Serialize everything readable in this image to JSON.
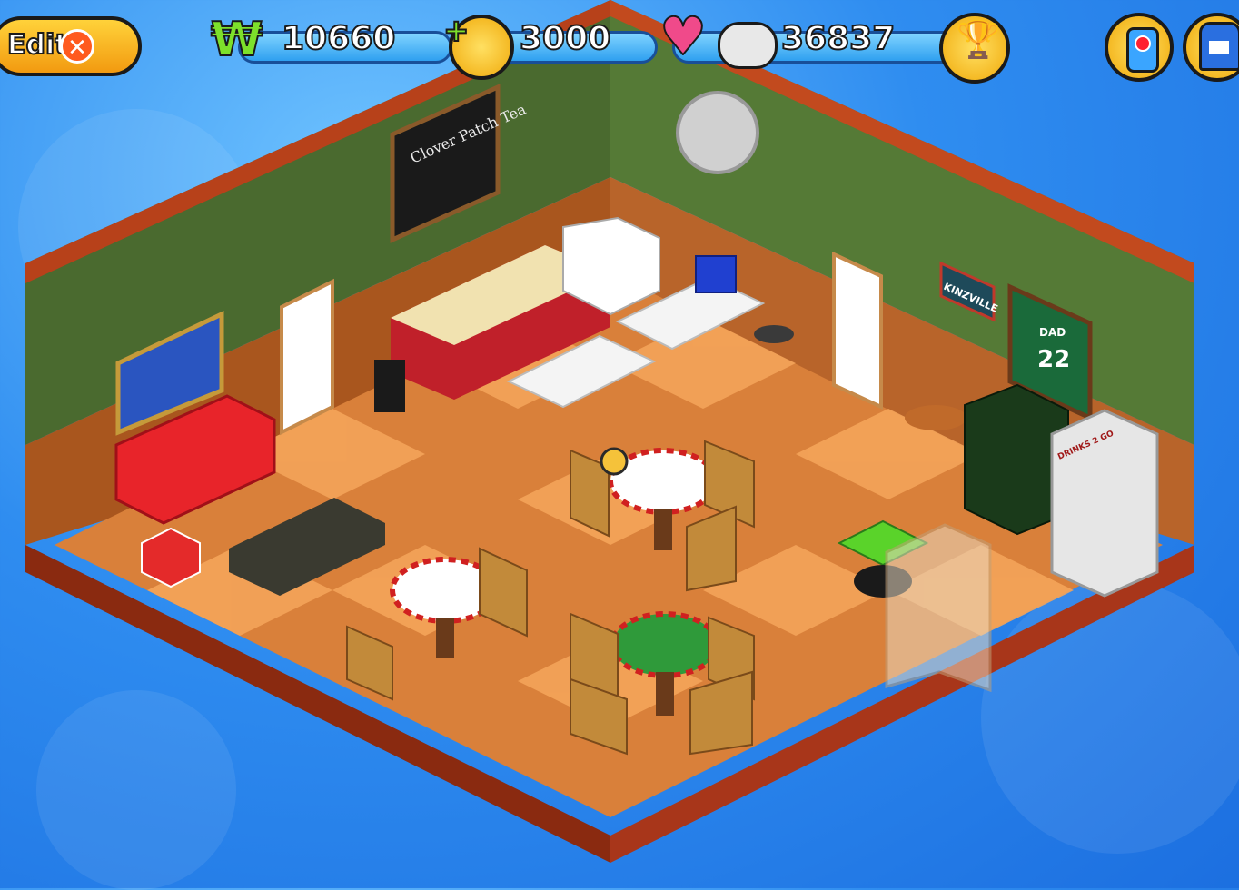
{
  "hud": {
    "edit_label": "Edit",
    "kinzcash": "10660",
    "gems": "3000",
    "happiness": "36837"
  },
  "room": {
    "chalkboard_text": "Clover Patch Tea",
    "sign_text": "KINZVILLE",
    "jersey_text": "DAD",
    "jersey_number": "22",
    "fridge_text": "DRINKS 2 GO"
  },
  "colors": {
    "wall_green": "#4a6a2f",
    "floor_light": "#f4a45a",
    "floor_dark": "#c05a1e",
    "wood_trim": "#b7411a",
    "hud_yellow": "#f7b820",
    "bg_blue": "#2f8df0"
  }
}
